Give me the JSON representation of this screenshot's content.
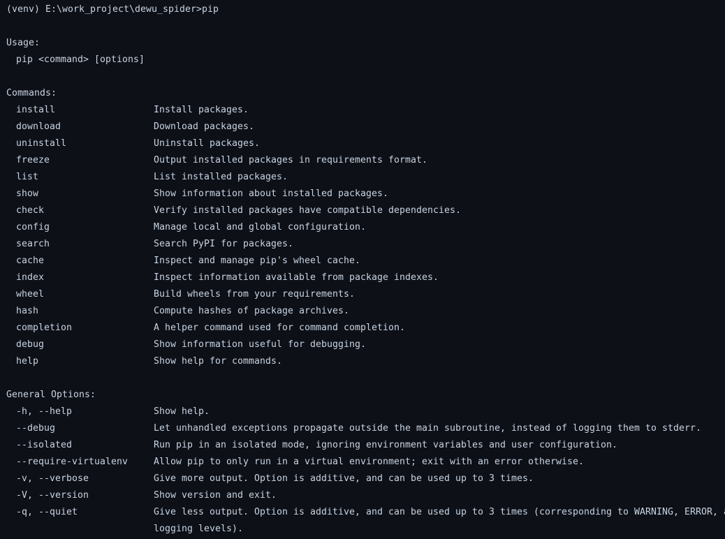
{
  "terminal": {
    "background_color": "#0d1017",
    "foreground_color": "#c9d4e2",
    "prompt_line": "(venv) E:\\work_project\\dewu_spider>pip",
    "usage_header": "Usage:",
    "usage_line": "pip <command> [options]",
    "commands_header": "Commands:",
    "commands": [
      {
        "name": "install",
        "description": "Install packages."
      },
      {
        "name": "download",
        "description": "Download packages."
      },
      {
        "name": "uninstall",
        "description": "Uninstall packages."
      },
      {
        "name": "freeze",
        "description": "Output installed packages in requirements format."
      },
      {
        "name": "list",
        "description": "List installed packages."
      },
      {
        "name": "show",
        "description": "Show information about installed packages."
      },
      {
        "name": "check",
        "description": "Verify installed packages have compatible dependencies."
      },
      {
        "name": "config",
        "description": "Manage local and global configuration."
      },
      {
        "name": "search",
        "description": "Search PyPI for packages."
      },
      {
        "name": "cache",
        "description": "Inspect and manage pip's wheel cache."
      },
      {
        "name": "index",
        "description": "Inspect information available from package indexes."
      },
      {
        "name": "wheel",
        "description": "Build wheels from your requirements."
      },
      {
        "name": "hash",
        "description": "Compute hashes of package archives."
      },
      {
        "name": "completion",
        "description": "A helper command used for command completion."
      },
      {
        "name": "debug",
        "description": "Show information useful for debugging."
      },
      {
        "name": "help",
        "description": "Show help for commands."
      }
    ],
    "general_options_header": "General Options:",
    "general_options": [
      {
        "flags": "-h, --help",
        "description": "Show help."
      },
      {
        "flags": "--debug",
        "description": "Let unhandled exceptions propagate outside the main subroutine, instead of logging them to stderr."
      },
      {
        "flags": "--isolated",
        "description": "Run pip in an isolated mode, ignoring environment variables and user configuration."
      },
      {
        "flags": "--require-virtualenv",
        "description": "Allow pip to only run in a virtual environment; exit with an error otherwise."
      },
      {
        "flags": "-v, --verbose",
        "description": "Give more output. Option is additive, and can be used up to 3 times."
      },
      {
        "flags": "-V, --version",
        "description": "Show version and exit."
      },
      {
        "flags": "-q, --quiet",
        "description": "Give less output. Option is additive, and can be used up to 3 times (corresponding to WARNING, ERROR, and CRITICAL"
      },
      {
        "flags": "",
        "description": "logging levels)."
      }
    ]
  }
}
